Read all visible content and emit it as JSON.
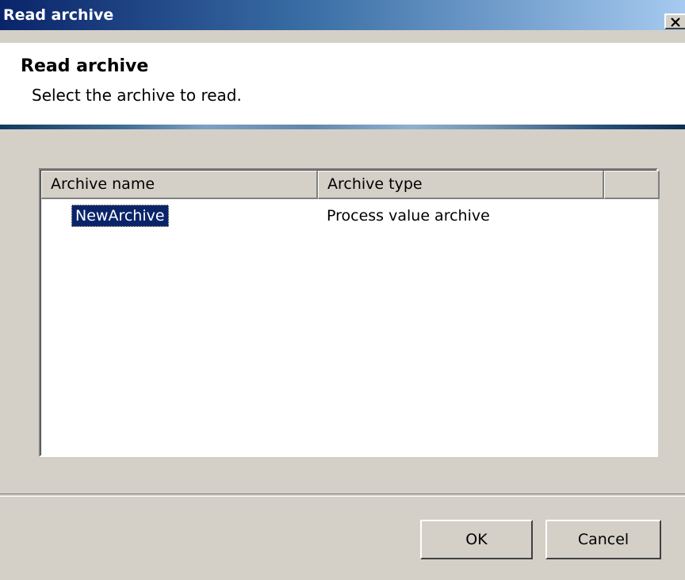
{
  "window": {
    "title": "Read archive",
    "close_glyph": "×"
  },
  "header": {
    "title": "Read archive",
    "subtitle": "Select the archive to read."
  },
  "list": {
    "columns": [
      "Archive name",
      "Archive type",
      ""
    ],
    "rows": [
      {
        "name": "NewArchive",
        "type": "Process value archive",
        "selected": true
      }
    ]
  },
  "buttons": {
    "ok": "OK",
    "cancel": "Cancel"
  },
  "colors": {
    "titlebar_start": "#0a246a",
    "titlebar_end": "#a6caf0",
    "selection": "#0a246a",
    "dialog_bg": "#d4d0c8"
  },
  "icons": [
    "close-icon"
  ]
}
